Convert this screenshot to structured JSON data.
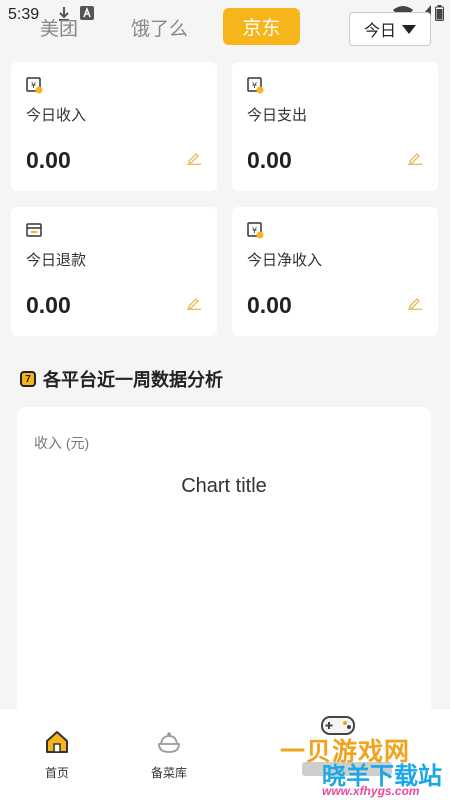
{
  "status": {
    "time": "5:39"
  },
  "tabs": [
    {
      "label": "美团",
      "active": false
    },
    {
      "label": "饿了么",
      "active": false
    },
    {
      "label": "京东",
      "active": true
    }
  ],
  "date_select": {
    "value": "今日"
  },
  "cards": [
    {
      "label": "今日收入",
      "value": "0.00",
      "icon": "yuan-note-icon"
    },
    {
      "label": "今日支出",
      "value": "0.00",
      "icon": "yuan-note-icon"
    },
    {
      "label": "今日退款",
      "value": "0.00",
      "icon": "refund-card-icon"
    },
    {
      "label": "今日净收入",
      "value": "0.00",
      "icon": "yuan-note-icon"
    }
  ],
  "section": {
    "badge": "7",
    "title": "各平台近一周数据分析"
  },
  "chart_data": {
    "type": "line",
    "title": "Chart title",
    "ylabel": "收入 (元)",
    "series": []
  },
  "bottom_nav": [
    {
      "label": "首页",
      "icon": "home-icon",
      "active": true
    },
    {
      "label": "备菜库",
      "icon": "dish-icon",
      "active": false
    }
  ],
  "watermark": {
    "line1": "一贝游戏网",
    "line2": "晓羊下载站",
    "url": "www.xfhygs.com"
  },
  "colors": {
    "accent": "#f6b51a",
    "background": "#f5f5f5",
    "edit_icon": "#e5b95c"
  }
}
